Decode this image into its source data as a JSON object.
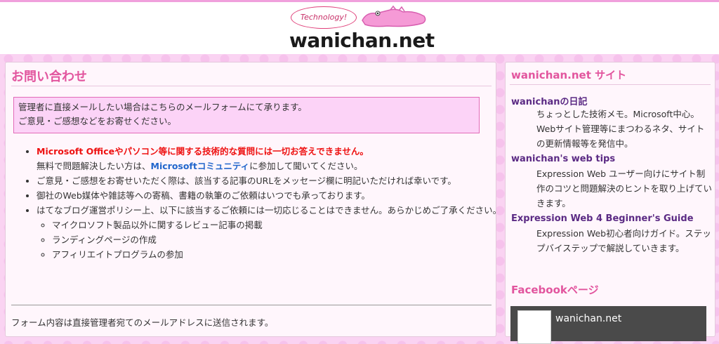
{
  "header": {
    "logo_bubble": "Technology!",
    "logo_text": "wanichan.net"
  },
  "main": {
    "title": "お問い合わせ",
    "notice_line1": "管理者に直接メールしたい場合はこちらのメールフォームにて承ります。",
    "notice_line2": "ご意見・ご感想などをお寄せください。",
    "items": [
      {
        "warn": "Microsoft Officeやパソコン等に関する技術的な質問には一切お答えできません。",
        "line2_pre": "無料で問題解決したい方は、",
        "line2_link": "Microsoftコミュニティ",
        "line2_post": "に参加して聞いてください。"
      },
      {
        "text": "ご意見・ご感想をお寄せいただく際は、該当する記事のURLをメッセージ欄に明記いただければ幸いです。"
      },
      {
        "text": "御社のWeb媒体や雑誌等への寄稿、書籍の執筆のご依頼はいつでも承っております。"
      },
      {
        "text": "はてなブログ運営ポリシー上、以下に該当するご依頼には一切応じることはできません。あらかじめご了承ください。",
        "sub": [
          "マイクロソフト製品以外に関するレビュー記事の掲載",
          "ランディングページの作成",
          "アフィリエイトプログラムの参加"
        ]
      }
    ],
    "form_note": "フォーム内容は直接管理者宛てのメールアドレスに送信されます。"
  },
  "side": {
    "title": "wanichan.net サイト",
    "items": [
      {
        "title": "wanichanの日記",
        "desc": "ちょっとした技術メモ。Microsoft中心。Webサイト管理等にまつわるネタ、サイトの更新情報等を発信中。"
      },
      {
        "title": "wanichan's web tips",
        "desc": "Expression Web ユーザー向けにサイト制作のコツと問題解決のヒントを取り上げていきます。"
      },
      {
        "title": "Expression Web 4 Beginner's Guide",
        "desc": "Expression Web初心者向けガイド。ステップバイステップで解説していきます。"
      }
    ],
    "fb_title": "Facebookページ",
    "fb_name": "wanichan.net"
  },
  "colors": {
    "accent_pink": "#e2559e",
    "warn_red": "#ee1111",
    "link_blue": "#2266cc",
    "side_link_purple": "#5b2a84"
  }
}
